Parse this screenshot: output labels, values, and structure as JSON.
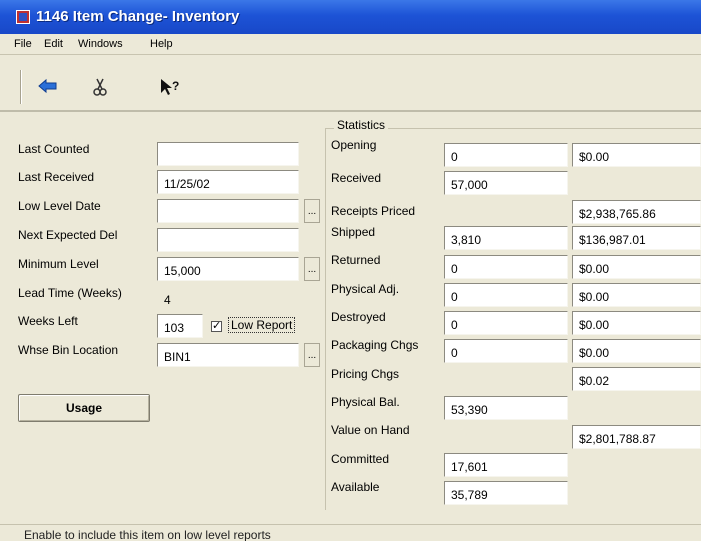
{
  "window": {
    "title": "1146 Item Change- Inventory"
  },
  "menu": {
    "file": "File",
    "edit": "Edit",
    "windows": "Windows",
    "help": "Help"
  },
  "toolbar": {
    "back_icon": "arrow-left-icon",
    "cut_icon": "scissors-icon",
    "help_icon": "pointer-help-icon",
    "help_glyph": "?"
  },
  "left": {
    "last_counted": {
      "label": "Last Counted",
      "value": ""
    },
    "last_received": {
      "label": "Last Received",
      "value": "11/25/02"
    },
    "low_level_date": {
      "label": "Low Level Date",
      "value": ""
    },
    "next_expected_del": {
      "label": "Next Expected Del",
      "value": ""
    },
    "minimum_level": {
      "label": "Minimum Level",
      "value": "15,000"
    },
    "lead_time": {
      "label": "Lead Time (Weeks)",
      "value": "4"
    },
    "weeks_left": {
      "label": "Weeks Left",
      "value": "103"
    },
    "low_report": {
      "label": "Low Report",
      "checked": true,
      "mark": "✓"
    },
    "whse_bin_location": {
      "label": "Whse Bin Location",
      "value": "BIN1"
    },
    "ellipsis": "...",
    "usage_button": "Usage"
  },
  "statistics": {
    "title": "Statistics",
    "rows": [
      {
        "label": "Opening",
        "qty": "0",
        "amount": "$0.00"
      },
      {
        "label": "Received",
        "qty": "57,000",
        "amount": null
      },
      {
        "label": "Receipts Priced",
        "qty": null,
        "amount": "$2,938,765.86"
      },
      {
        "label": "Shipped",
        "qty": "3,810",
        "amount": "$136,987.01"
      },
      {
        "label": "Returned",
        "qty": "0",
        "amount": "$0.00"
      },
      {
        "label": "Physical Adj.",
        "qty": "0",
        "amount": "$0.00"
      },
      {
        "label": "Destroyed",
        "qty": "0",
        "amount": "$0.00"
      },
      {
        "label": "Packaging Chgs",
        "qty": "0",
        "amount": "$0.00"
      },
      {
        "label": "Pricing Chgs",
        "qty": null,
        "amount": "$0.02"
      },
      {
        "label": "Physical Bal.",
        "qty": "53,390",
        "amount": null
      },
      {
        "label": "Value on Hand",
        "qty": null,
        "amount": "$2,801,788.87"
      },
      {
        "label": "Committed",
        "qty": "17,601",
        "amount": null
      },
      {
        "label": "Available",
        "qty": "35,789",
        "amount": null
      }
    ]
  },
  "status_bar": {
    "text": "Enable to include this item on low level reports"
  },
  "colors": {
    "titlebar": "#1d53d6",
    "window_bg": "#ece9d8",
    "field_bg": "#ffffff"
  }
}
